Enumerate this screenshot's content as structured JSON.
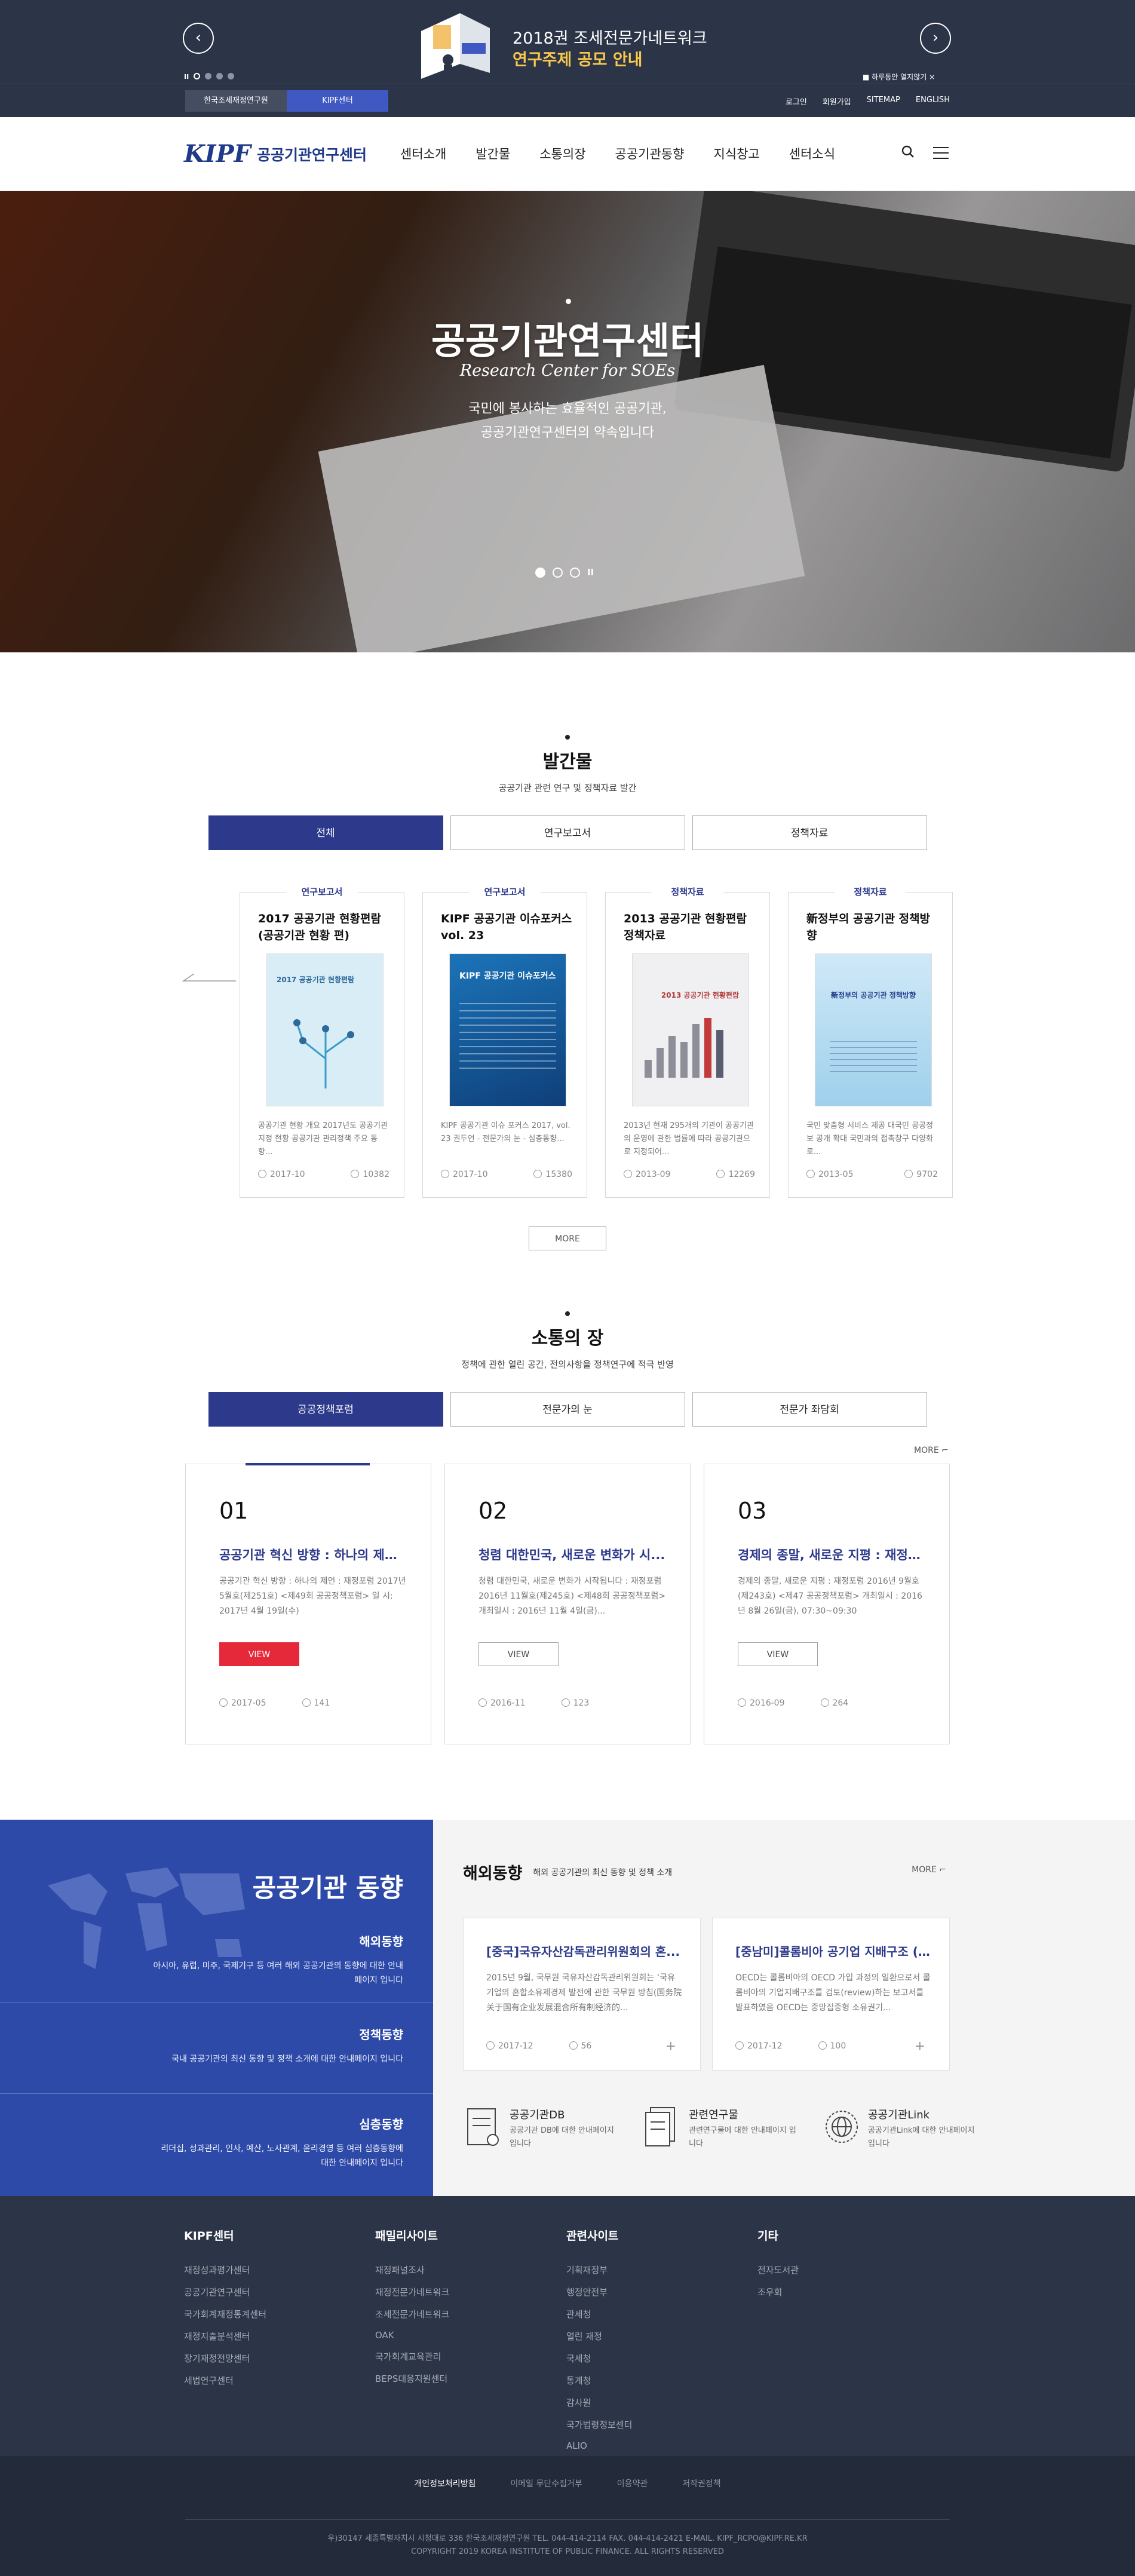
{
  "promo": {
    "title": "2018권 조세전문가네트워크",
    "subtitle": "연구주제 공모 안내",
    "dismiss_label": "하루동안 열지않기",
    "dismiss_close": "×",
    "prev": "‹",
    "next": "›",
    "pause": "II"
  },
  "util": {
    "sites": [
      "한국조세재정연구원",
      "KIPF센터"
    ],
    "links": [
      "로그인",
      "회원가입",
      "SITEMAP",
      "ENGLISH"
    ]
  },
  "header": {
    "logo_mark": "KIPF",
    "logo_text": "공공기관연구센터",
    "nav": [
      "센터소개",
      "발간물",
      "소통의장",
      "공공기관동향",
      "지식창고",
      "센터소식"
    ]
  },
  "hero": {
    "title": "공공기관연구센터",
    "title_en": "Research Center for SOEs",
    "subtitle_1": "국민에 봉사하는 효율적인 공공기관,",
    "subtitle_2": "공공기관연구센터의 약속입니다",
    "pause": "II"
  },
  "publications": {
    "title": "발간물",
    "desc": "공공기관 관련 연구 및 정책자료 발간",
    "tabs": [
      "전체",
      "연구보고서",
      "정책자료"
    ],
    "more": "MORE",
    "cards": [
      {
        "category": "연구보고서",
        "title": "2017 공공기관 현황편람 (공공기관 현황 편)",
        "cover_title": "2017 공공기관 현황편람",
        "desc": "공공기관 현황 개요 2017년도 공공기관 지정 현황 공공기관 관리정책 주요 동향...",
        "date": "2017-10",
        "views": "10382"
      },
      {
        "category": "연구보고서",
        "title": "KIPF 공공기관 이슈포커스 vol. 23",
        "cover_title": "KIPF 공공기관 이슈포커스",
        "desc": "KIPF 공공기관 이슈 포커스 2017, vol. 23 권두언 - 전문가의 눈 - 심층동향...",
        "date": "2017-10",
        "views": "15380"
      },
      {
        "category": "정책자료",
        "title": "2013 공공기관 현황편람 정책자료",
        "cover_title": "2013 공공기관 현황편람",
        "desc": "2013년 현재 295개의 기관이 공공기관의 운영에 관한 법률에 따라 공공기관으로 지정되어...",
        "date": "2013-09",
        "views": "12269"
      },
      {
        "category": "정책자료",
        "title": "新정부의 공공기관 정책방향",
        "cover_title": "新정부의 공공기관 정책방향",
        "desc": "국민 맞춤형 서비스 제공 대국민 공공정보 공개 확대 국민과의 접촉창구 다양화로...",
        "date": "2013-05",
        "views": "9702"
      }
    ]
  },
  "communication": {
    "title": "소통의 장",
    "desc": "정책에 관한 열린 공간, 전의사항을 정책연구에 적극 반영",
    "tabs": [
      "공공정책포럼",
      "전문가의 눈",
      "전문가 좌담회"
    ],
    "more": "MORE",
    "cards": [
      {
        "no": "01",
        "title": "공공기관 혁신 방향 : 하나의 제언...",
        "desc": "공공기관 혁신 방향 : 하나의 제언 : 재정포럼 2017년 5월호(제251호) <제49회 공공정책포럼> 일 시: 2017년 4월 19일(수)",
        "view": "VIEW",
        "date": "2017-05",
        "views": "141"
      },
      {
        "no": "02",
        "title": "청렴 대한민국, 새로운 변화가 시...",
        "desc": "청렴 대한민국, 새로운 변화가 시작됩니다 : 재정포럼 2016년 11월호(제245호) <제48회 공공정책포럼> 개최일시 : 2016년 11월 4일(금)...",
        "view": "VIEW",
        "date": "2016-11",
        "views": "123"
      },
      {
        "no": "03",
        "title": "경제의 종말, 새로운 지평 : 재정포...",
        "desc": "경제의 종말, 새로운 지평 : 재정포럼 2016년 9월호(제243호) <제47 공공정책포럼> 개최일시 : 2016년 8월 26일(금), 07:30~09:30",
        "view": "VIEW",
        "date": "2016-09",
        "views": "264"
      }
    ]
  },
  "trends": {
    "title": "공공기관 동향",
    "items": [
      {
        "label": "해외동향",
        "desc": "아시아, 유럽, 미주, 국제기구 등 여러 해외 공공기관의 동향에 대한 안내페이지 입니다"
      },
      {
        "label": "정책동향",
        "desc": "국내 공공기관의 최신 동향 및 정책 소개에 대한 안내페이지 입니다"
      },
      {
        "label": "심층동향",
        "desc": "리더십, 성과관리, 인사, 예산, 노사관계, 윤리경영 등 여러 심층동향에 대한 안내페이지 입니다"
      }
    ],
    "section_title": "해외동향",
    "section_desc": "해외 공공기관의 최신 동향 및 정책 소개",
    "more": "MORE",
    "cards": [
      {
        "title": "[중국]국유자산감독관리위원회의 혼...",
        "desc": "2015년 9월, 국무원 국유자산감독관리위원회는 ‘국유기업의 혼합소유제경제 발전에 관한 국무원 방침(国务院关于国有企业发展混合所有制经济的...",
        "date": "2017-12",
        "views": "56",
        "plus": "+"
      },
      {
        "title": "[중남미]콜롬비아 공기업 지배구조 (1...",
        "desc": "OECD는 콜롬비아의 OECD 가입 과정의 일환으로서 콜롬비아의 기업지배구조를 검토(review)하는 보고서를 발표하였음 OECD는 중앙집중형 소유권기...",
        "date": "2017-12",
        "views": "100",
        "plus": "+"
      }
    ],
    "services": [
      {
        "label": "공공기관DB",
        "desc": "공공기관 DB에 대한 안내페이지 입니다"
      },
      {
        "label": "관련연구물",
        "desc": "관련연구물에 대한 안내페이지 입니다"
      },
      {
        "label": "공공기관Link",
        "desc": "공공기관Link에 대한 안내페이지 입니다"
      }
    ]
  },
  "footer": {
    "columns": [
      {
        "title": "KIPF센터",
        "links": [
          "재정성과평가센터",
          "공공기관연구센터",
          "국가회계재정통계센터",
          "재정지출분석센터",
          "장기재정전망센터",
          "세법연구센터"
        ]
      },
      {
        "title": "패밀리사이트",
        "links": [
          "재정패널조사",
          "재정전문가네트워크",
          "조세전문가네트워크",
          "OAK",
          "국가회계교육관리",
          "BEPS대응지원센터"
        ]
      },
      {
        "title": "관련사이트",
        "links": [
          "기획재정부",
          "행정안전부",
          "관세청",
          "열린 재정",
          "국세청",
          "통계청",
          "감사원",
          "국가법령정보센터",
          "ALIO"
        ]
      },
      {
        "title": "기타",
        "links": [
          "전자도서관",
          "조우회"
        ]
      }
    ],
    "bottom_links": [
      "개인정보처리방침",
      "이메일 무단수집거부",
      "이용약관",
      "저작권정책"
    ],
    "address": "우)30147 세종특별자치시 시청대로 336 한국조세재정연구원 TEL. 044-414-2114 FAX. 044-414-2421 E-MAIL. KIPF_RCPO@KIPF.RE.KR",
    "copyright": "COPYRIGHT 2019 KOREA INSTITUTE OF PUBLIC FINANCE. ALL RIGHTS RESERVED"
  }
}
